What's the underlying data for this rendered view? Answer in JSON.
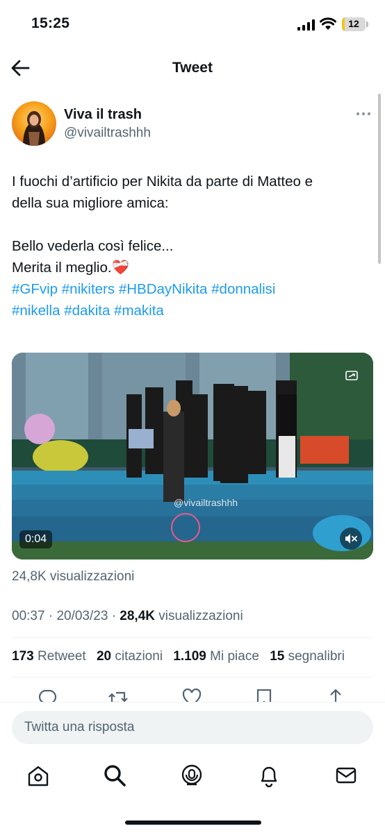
{
  "status_bar": {
    "time": "15:25",
    "battery": "12",
    "battery_color": "#f5c518"
  },
  "header": {
    "title": "Tweet",
    "back_icon": "arrow-left-icon"
  },
  "tweet": {
    "author_name": "Viva il trash",
    "author_handle": "@vivailtrashhh",
    "text_lines": [
      "I fuochi d’artificio per Nikita da parte di Matteo e",
      "della sua migliore amica:",
      "Bello vederla così felice...",
      "Merita il meglio."
    ],
    "emoji": "❤️‍🩹",
    "hashtags_line1": [
      "#GFvip",
      "#nikiters",
      "#HBDayNikita",
      "#donnalisi"
    ],
    "hashtags_line2": [
      "#nikella",
      "#dakita",
      "#makita"
    ],
    "link_color": "#1d9bf0"
  },
  "video": {
    "duration": "0:04",
    "watermark": "@vivailtrashhh",
    "views": "24,8K visualizzazioni"
  },
  "meta": {
    "time": "00:37",
    "separator": "·",
    "date": "20/03/23",
    "views_count": "28,4K",
    "views_label": "visualizzazioni"
  },
  "stats": {
    "retweets_count": "173",
    "retweets_label": "Retweet",
    "quotes_count": "20",
    "quotes_label": "citazioni",
    "likes_count": "1.109",
    "likes_label": "Mi piace",
    "bookmarks_count": "15",
    "bookmarks_label": "segnalibri"
  },
  "actions": [
    "reply-icon",
    "retweet-icon",
    "like-icon",
    "bookmark-icon",
    "share-icon"
  ],
  "reply": {
    "placeholder": "Twitta una risposta"
  },
  "tabbar": [
    "home-icon",
    "search-icon",
    "spaces-icon",
    "notifications-icon",
    "messages-icon"
  ],
  "colors": {
    "text": "#0f1419",
    "secondary": "#536471",
    "accent": "#1d9bf0"
  }
}
